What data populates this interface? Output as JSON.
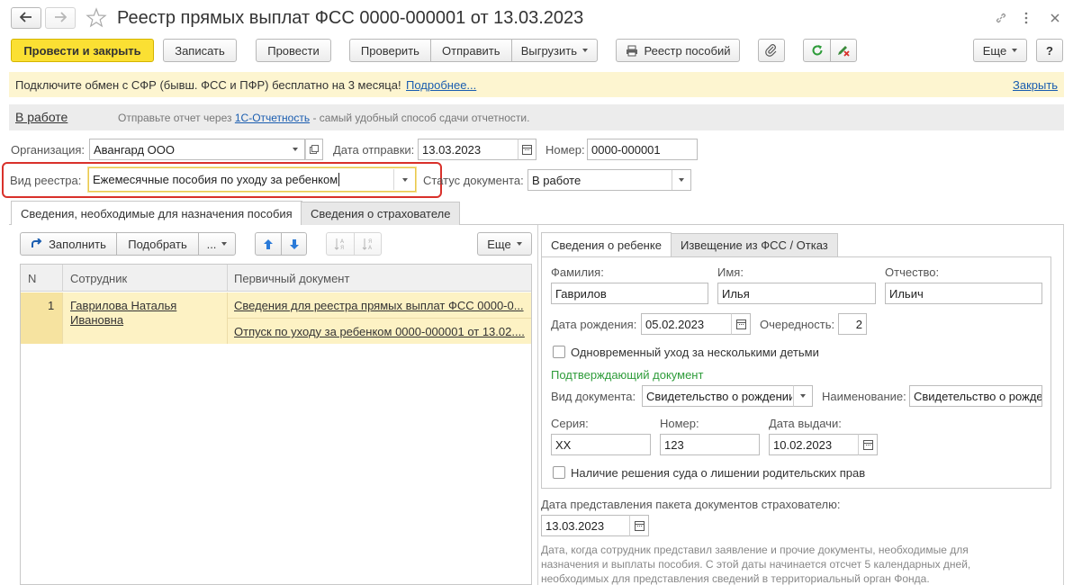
{
  "window": {
    "title": "Реестр прямых выплат ФСС 0000-000001 от 13.03.2023"
  },
  "toolbar": {
    "post_and_close": "Провести и закрыть",
    "write": "Записать",
    "post": "Провести",
    "check": "Проверить",
    "send": "Отправить",
    "upload": "Выгрузить",
    "benefits_registry": "Реестр пособий",
    "more": "Еще",
    "help": "?"
  },
  "banner": {
    "text": "Подключите обмен с СФР (бывш. ФСС и ПФР) бесплатно на 3 месяца!",
    "more_link": "Подробнее...",
    "close_link": "Закрыть"
  },
  "status_bar": {
    "state": "В работе",
    "prefix": "Отправьте отчет через",
    "link": "1С-Отчетность",
    "suffix": " - самый удобный способ сдачи отчетности."
  },
  "header": {
    "org_label": "Организация:",
    "org_value": "Авангард ООО",
    "send_date_label": "Дата отправки:",
    "send_date_value": "13.03.2023",
    "number_label": "Номер:",
    "number_value": "0000-000001",
    "registry_type_label": "Вид реестра:",
    "registry_type_value": "Ежемесячные пособия по уходу за ребенком",
    "doc_status_label": "Статус документа:",
    "doc_status_value": "В работе"
  },
  "tabs": [
    "Сведения, необходимые для назначения пособия",
    "Сведения о страхователе"
  ],
  "list_toolbar": {
    "fill": "Заполнить",
    "select": "Подобрать",
    "dots": "...",
    "more": "Еще"
  },
  "table": {
    "columns": [
      "N",
      "Сотрудник",
      "Первичный документ"
    ],
    "rows": [
      {
        "n": "1",
        "employee": "Гаврилова Наталья Ивановна",
        "documents": [
          "Сведения для реестра прямых выплат ФСС 0000-0...",
          "Отпуск по уходу за ребенком 0000-000001 от 13.02...."
        ]
      }
    ]
  },
  "child_tabs": [
    "Сведения о ребенке",
    "Извещение из ФСС / Отказ"
  ],
  "child": {
    "last_name_label": "Фамилия:",
    "last_name": "Гаврилов",
    "first_name_label": "Имя:",
    "first_name": "Илья",
    "patronymic_label": "Отчество:",
    "patronymic": "Ильич",
    "birth_date_label": "Дата рождения:",
    "birth_date": "05.02.2023",
    "order_label": "Очередность:",
    "order": "2",
    "simultaneous_care": "Одновременный уход за несколькими детьми",
    "confirm_doc_header": "Подтверждающий документ",
    "doc_type_label": "Вид документа:",
    "doc_type": "Свидетельство о рождении",
    "doc_name_label": "Наименование:",
    "doc_name": "Свидетельство о рожде",
    "series_label": "Серия:",
    "series": "XX",
    "number_label": "Номер:",
    "number": "123",
    "issue_date_label": "Дата выдачи:",
    "issue_date": "10.02.2023",
    "court_decision": "Наличие решения суда о лишении родительских прав"
  },
  "package": {
    "label": "Дата представления пакета документов страхователю:",
    "date": "13.03.2023",
    "hint": "Дата, когда сотрудник представил заявление и прочие документы, необходимые для назначения и выплаты пособия. С этой даты начинается отсчет 5 календарных дней, необходимых для представления сведений в территориальный орган Фонда."
  },
  "colors": {
    "primary_button": "#fbe033",
    "banner_bg": "#fdf5d0",
    "link": "#1a5db0",
    "highlight_border": "#d9312b",
    "selected_row": "#fdf2c4",
    "section_green": "#2e9c3a"
  }
}
